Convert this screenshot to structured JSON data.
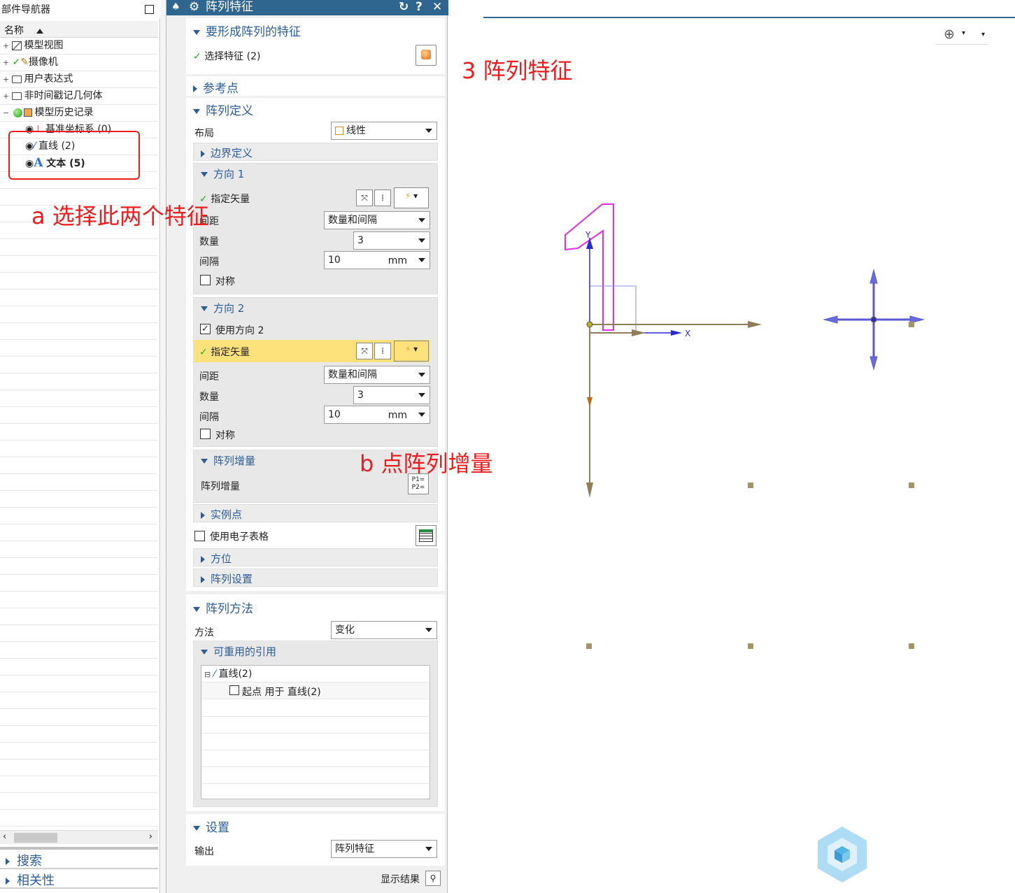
{
  "navigator": {
    "title": "部件导航器",
    "column_header": "名称",
    "items": [
      {
        "label": "模型视图"
      },
      {
        "label": "摄像机"
      },
      {
        "label": "用户表达式"
      },
      {
        "label": "非时间戳记几何体"
      },
      {
        "label": "模型历史记录"
      },
      {
        "label": "基准坐标系 (0)"
      },
      {
        "label": "直线 (2)"
      },
      {
        "label": "文本 (5)"
      }
    ],
    "bottom_sections": [
      {
        "label": "搜索"
      },
      {
        "label": "相关性"
      }
    ]
  },
  "dialog": {
    "title": "阵列特征",
    "sec_features": {
      "title": "要形成阵列的特征",
      "select_label": "选择特征 (2)"
    },
    "sec_reference": {
      "title": "参考点"
    },
    "sec_definition": {
      "title": "阵列定义",
      "layout_label": "布局",
      "layout_value": "线性",
      "boundary": "边界定义",
      "dir1": {
        "title": "方向 1",
        "vector_label": "指定矢量",
        "spacing_label": "间距",
        "spacing_value": "数量和间隔",
        "count_label": "数量",
        "count_value": "3",
        "pitch_label": "间隔",
        "pitch_value": "10",
        "pitch_unit": "mm",
        "symmetric_label": "对称"
      },
      "dir2": {
        "title": "方向 2",
        "use_label": "使用方向 2",
        "vector_label": "指定矢量",
        "spacing_label": "间距",
        "spacing_value": "数量和间隔",
        "count_label": "数量",
        "count_value": "3",
        "pitch_label": "间隔",
        "pitch_value": "10",
        "pitch_unit": "mm",
        "symmetric_label": "对称"
      },
      "increment": {
        "title": "阵列增量",
        "label": "阵列增量",
        "button_text": "P1= P2="
      },
      "instance_points": "实例点",
      "spreadsheet_label": "使用电子表格",
      "orientation": "方位",
      "settings": "阵列设置"
    },
    "sec_method": {
      "title": "阵列方法",
      "method_label": "方法",
      "method_value": "变化",
      "reusable_title": "可重用的引用",
      "tree": [
        {
          "label": "直线(2)"
        },
        {
          "label": "起点 用于 直线(2)"
        }
      ]
    },
    "sec_settings": {
      "title": "设置",
      "output_label": "输出",
      "output_value": "阵列特征"
    },
    "show_result": "显示结果"
  },
  "annotations": {
    "a": "a 选择此两个特征",
    "b": "b 点阵列增量",
    "c": "3  阵列特征"
  },
  "viewport": {
    "axis_x_label": "X",
    "axis_y_label": "Y"
  },
  "colors": {
    "title_blue": "#2f6690",
    "section_blue": "#2b5d99",
    "annotation_red": "#ee1c1c",
    "highlight_yellow": "#fde27c",
    "text_magenta": "#e030e0"
  }
}
